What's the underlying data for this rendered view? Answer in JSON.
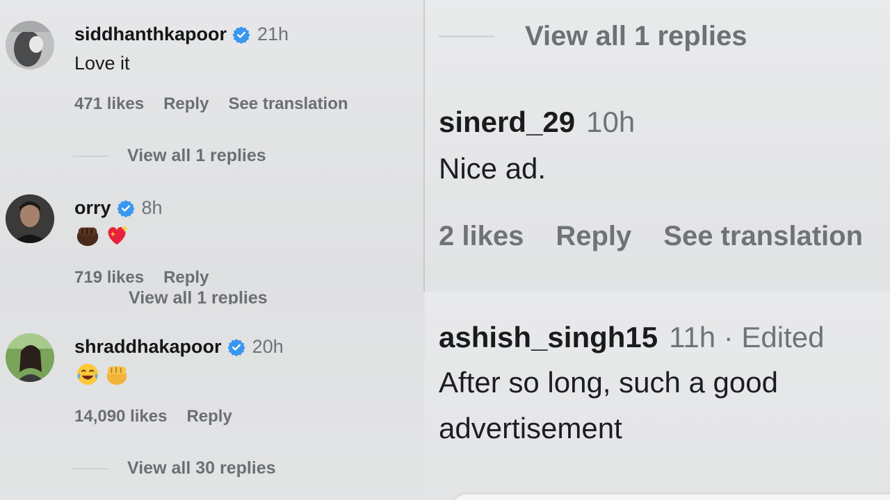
{
  "left_panel": {
    "comments": [
      {
        "username": "siddhanthkapoor",
        "verified": true,
        "time": "21h",
        "text": "Love it",
        "likes": "471 likes",
        "reply_label": "Reply",
        "translation_label": "See translation",
        "view_replies": "View all 1 replies",
        "avatar_icon": "profile-photo-grayscale"
      },
      {
        "username": "orry",
        "verified": true,
        "time": "8h",
        "emojis": [
          "raised-fist-dark-skin-emoji",
          "sparkling-heart-emoji"
        ],
        "likes": "719 likes",
        "reply_label": "Reply",
        "view_replies": "View all 1 replies",
        "avatar_icon": "profile-photo"
      },
      {
        "username": "shraddhakapoor",
        "verified": true,
        "time": "20h",
        "emojis": [
          "tears-of-joy-emoji",
          "raised-fist-emoji"
        ],
        "likes": "14,090 likes",
        "reply_label": "Reply",
        "view_replies": "View all 30 replies",
        "avatar_icon": "profile-photo-outdoor"
      }
    ]
  },
  "right_panel": {
    "top": {
      "view_replies": "View all 1 replies",
      "comment": {
        "username": "sinerd_29",
        "time": "10h",
        "text": "Nice ad.",
        "likes": "2 likes",
        "reply_label": "Reply",
        "translation_label": "See translation"
      }
    },
    "bottom": {
      "comment": {
        "username": "ashish_singh15",
        "time": "11h · Edited",
        "text_line1": "After so long, such a good",
        "text_line2": "advertisement"
      }
    }
  },
  "colors": {
    "verified_badge": "#3897f0",
    "muted_text": "#6f7378",
    "primary_text": "#1a1b1d"
  }
}
